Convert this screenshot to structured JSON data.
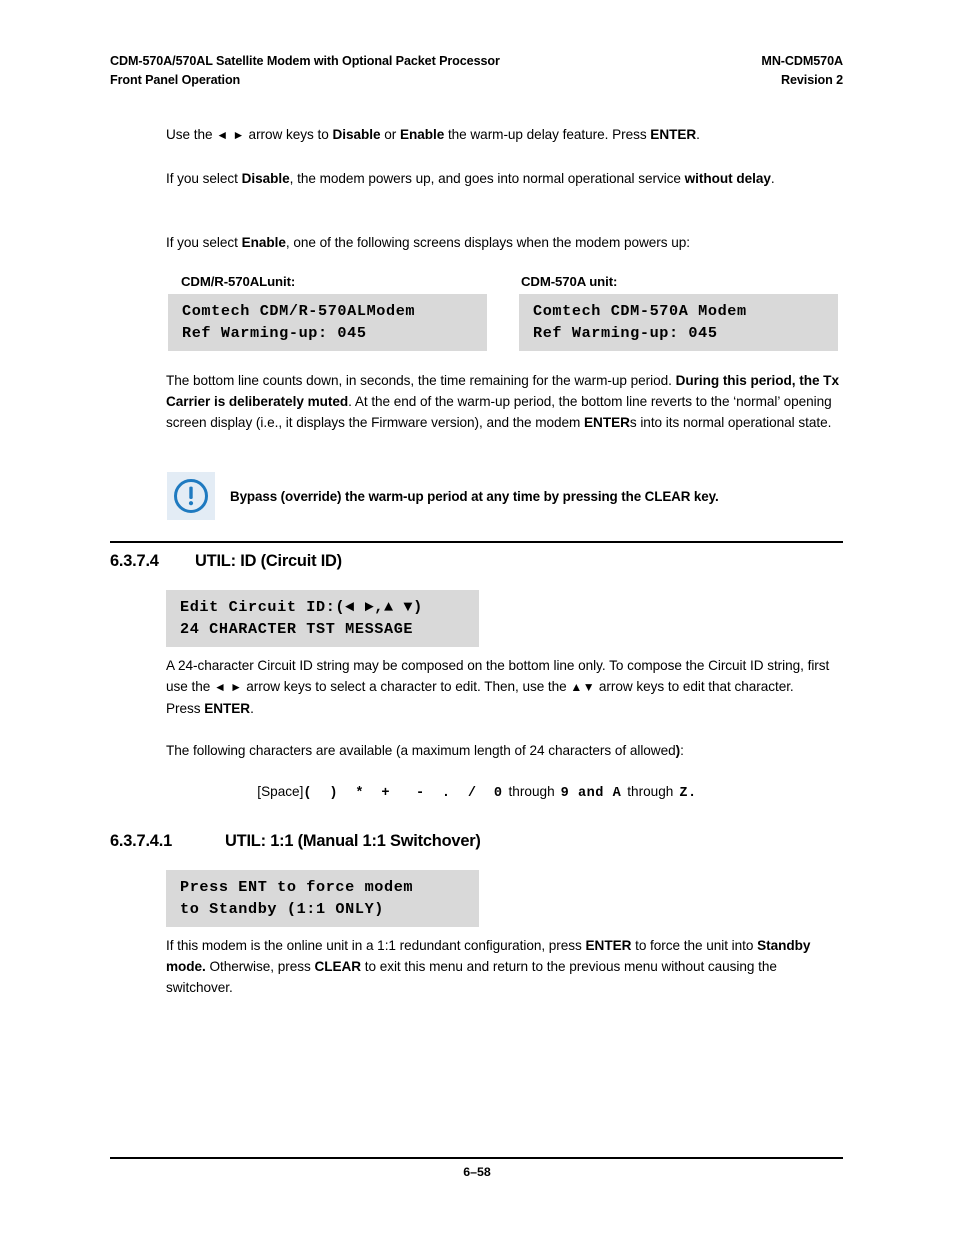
{
  "document": {
    "header": {
      "left_line1": "CDM-570A/570AL Satellite Modem with Optional Packet Processor",
      "left_line2": "Front Panel Operation",
      "right_line1": "MN-CDM570A",
      "right_line2": "Revision 2"
    },
    "footer": {
      "page_number": "6–58"
    }
  },
  "paragraphs": {
    "p1": {
      "t1": "Use the ",
      "arrows": "◄ ►",
      "t2": " arrow keys to ",
      "b1": "Disable",
      "t3": " or ",
      "b2": "Enable",
      "t4": " the warm-up delay feature. Press ",
      "b3": "ENTER",
      "t5": "."
    },
    "p2": {
      "t1": "If you select ",
      "b1": "Disable",
      "t2": ", the modem powers up, and goes into normal operational service ",
      "b2": "without delay",
      "t3": "."
    },
    "p3": {
      "t1": "If you select ",
      "b1": "Enable",
      "t2": ", one of the following screens displays when the modem powers up:"
    },
    "p4": {
      "t1": "The bottom line counts down, in seconds, the time remaining for the warm-up period. ",
      "b1": "During this period, the Tx Carrier is deliberately muted",
      "t2": ". At the end of the warm-up period, the bottom line reverts to the ‘normal’ opening screen display (i.e., it displays the Firmware version), and the modem ",
      "b2": "ENTER",
      "t3": "s into its normal operational state."
    },
    "p5": {
      "t1": "A 24-character Circuit ID string may be composed on the bottom line only. To compose the Circuit ID string, first use the ",
      "arrows1": "◄ ►",
      "t2": " arrow keys to select a character to edit. Then, use the ",
      "arrows2": "▲▼",
      "t3": " arrow keys to edit that character. Press ",
      "b1": "ENTER",
      "t4": "."
    },
    "p6": {
      "t1": "The following characters are available (a maximum length of 24 characters of allowed",
      "b1": ")",
      "t2": ":"
    },
    "p7": {
      "t1": "If this modem is the online unit in a 1:1 redundant configuration, press ",
      "b1": "ENTER",
      "t2": " to force the unit into ",
      "b2": "Standby mode.",
      "t3": " Otherwise, press ",
      "b3": "CLEAR",
      "t4": " to exit this menu and return to the previous menu without causing the switchover."
    }
  },
  "char_list": {
    "space_label": "[Space]",
    "symbols": "(  )  *  +   -  .  /  0",
    "through1": "through",
    "digit9_and_A": "9 and A",
    "through2": "through",
    "endZ": "Z."
  },
  "lcd_screens": {
    "warmup_left": {
      "caption": "CDM/R-570ALunit:",
      "line1": "Comtech CDM/R-570ALModem",
      "line2": "Ref Warming-up: 045"
    },
    "warmup_right": {
      "caption": "CDM-570A unit:",
      "line1": "Comtech CDM-570A Modem",
      "line2": "Ref Warming-up: 045"
    },
    "circuit_id": {
      "line1": "Edit Circuit ID:(◄ ►,▲ ▼)",
      "line2": "24 CHARACTER TST MESSAGE"
    },
    "switchover": {
      "line1": "Press ENT to force modem",
      "line2": "to Standby (1:1 ONLY)"
    }
  },
  "note": {
    "icon": "information-icon",
    "text": "Bypass (override) the warm-up period at any time by pressing the CLEAR key."
  },
  "headings": {
    "h1": {
      "number": "6.3.7.4",
      "title": "UTIL: ID (Circuit ID)"
    },
    "h2": {
      "number": "6.3.7.4.1",
      "title": "UTIL: 1:1 (Manual 1:1 Switchover)"
    }
  },
  "colors": {
    "lcd_background": "#d9d9d9",
    "note_icon_background": "#e3ecf5",
    "note_icon_blue": "#1f7ac0",
    "text": "#000000"
  }
}
